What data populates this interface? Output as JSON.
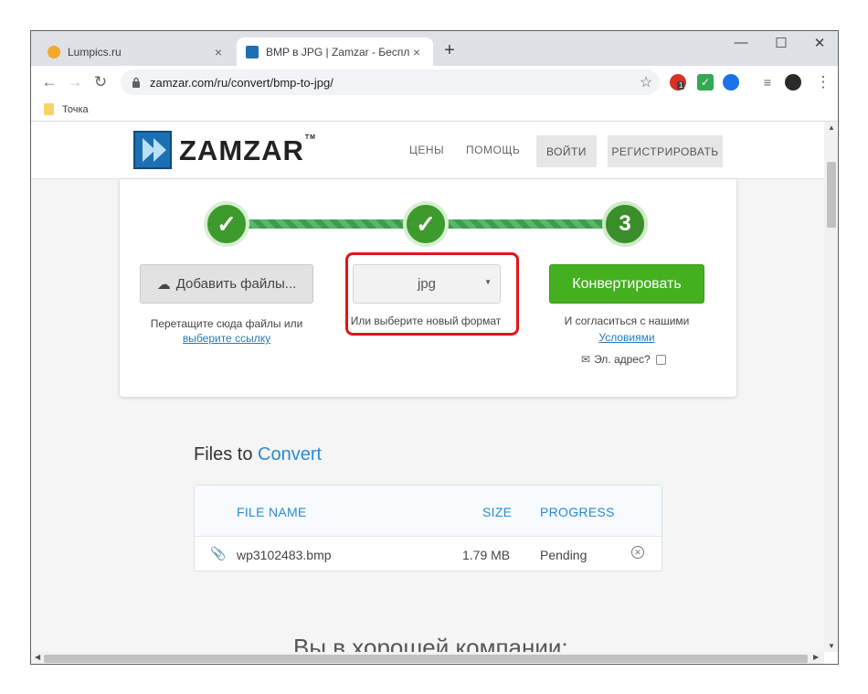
{
  "browser": {
    "tabs": [
      {
        "title": "Lumpics.ru",
        "favicon_color": "#f3a82b",
        "active": false
      },
      {
        "title": "BMP в JPG | Zamzar - Бесплатна",
        "favicon_color": "#1d6fb3",
        "active": true
      }
    ],
    "tab_close_glyph": "×",
    "new_tab_glyph": "+",
    "window_controls": {
      "minimize": "—",
      "maximize": "☐",
      "close": "✕"
    },
    "url": "zamzar.com/ru/convert/bmp-to-jpg/",
    "bookmark_label": "Точка",
    "extension_badge": "1"
  },
  "header": {
    "logo_text": "ZAMZAR",
    "logo_tm": "TM",
    "nav": {
      "prices": "ЦЕНЫ",
      "help": "ПОМОЩЬ"
    },
    "login": "ВОЙТИ",
    "register": "РЕГИСТРИРОВАТЬ"
  },
  "converter": {
    "steps": {
      "step1": "✓",
      "step2": "✓",
      "step3": "3"
    },
    "add_files": "Добавить файлы...",
    "drag_text": "Перетащите сюда файлы или",
    "drag_link": "выберите ссылку",
    "format_value": "jpg",
    "format_hint": "Или выберите новый формат",
    "convert_button": "Конвертировать",
    "agree_text": "И согласиться с нашими",
    "agree_link": "Условиями",
    "email_label": "Эл. адрес?"
  },
  "files": {
    "heading_start": "Files to",
    "heading_accent": "Convert",
    "columns": {
      "name": "FILE NAME",
      "size": "SIZE",
      "progress": "PROGRESS"
    },
    "rows": [
      {
        "name": "wp3102483.bmp",
        "size": "1.79 MB",
        "progress": "Pending"
      }
    ]
  },
  "footer_partial": "Вы в хорошей компании:",
  "colors": {
    "accent": "#2a8ad3",
    "green": "#44b020",
    "highlight": "#e3141c"
  }
}
